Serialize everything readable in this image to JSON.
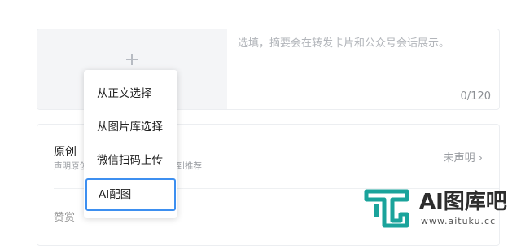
{
  "cover": {
    "add_icon": "plus-icon",
    "summary_placeholder": "选填，摘要会在转发卡片和公众号会话展示。",
    "summary_value": "",
    "char_count": "0/120"
  },
  "original": {
    "title": "原创",
    "description": "声明原创           作权保护，并有可能得到推荐",
    "status": "未声明 ›"
  },
  "reward": {
    "label": "赞赏"
  },
  "cover_menu": {
    "items": [
      {
        "label": "从正文选择"
      },
      {
        "label": "从图片库选择"
      },
      {
        "label": "微信扫码上传"
      },
      {
        "label": "AI配图",
        "selected": true
      }
    ]
  },
  "watermark": {
    "brand": "AI图库吧",
    "url": "www.aituku.cc",
    "colors": {
      "logo": "#1aa39b",
      "text": "#2d2d2d"
    }
  }
}
